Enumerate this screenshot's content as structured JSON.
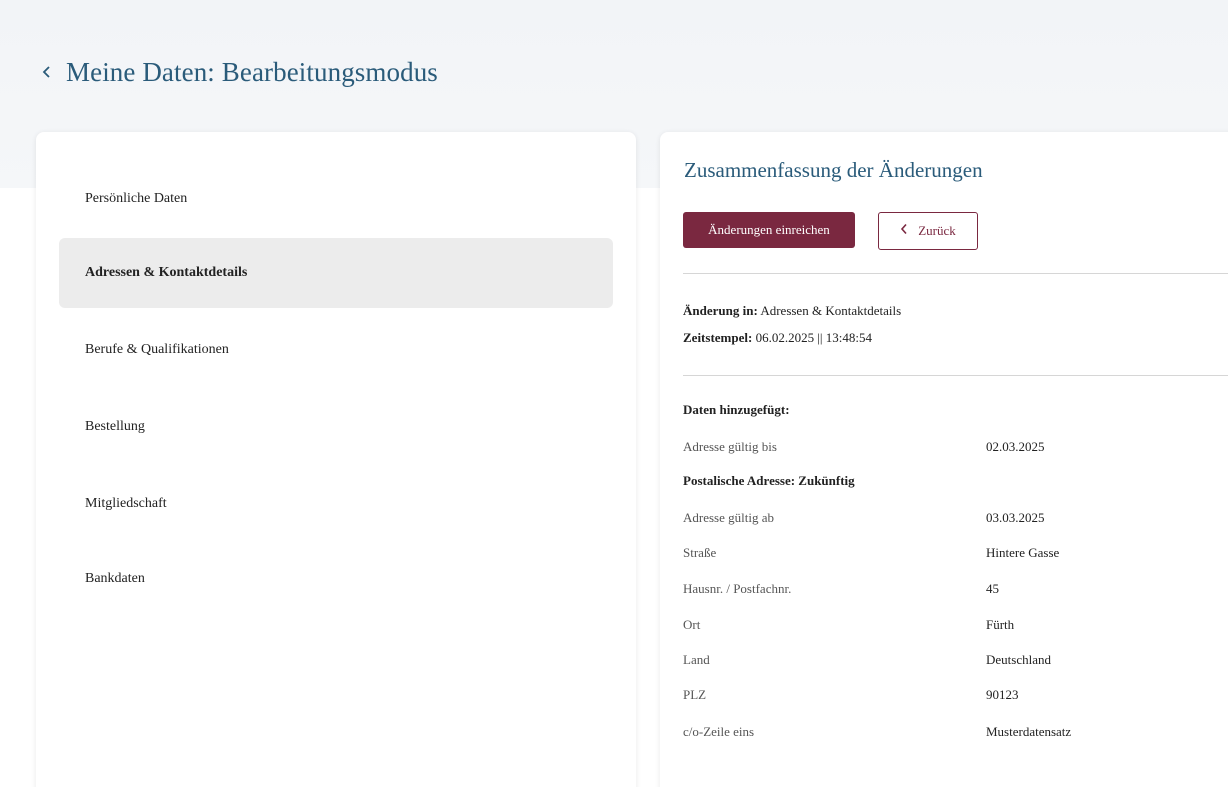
{
  "header": {
    "title": "Meine Daten: Bearbeitungsmodus"
  },
  "sidebar": {
    "items": [
      {
        "label": "Persönliche Daten",
        "active": false
      },
      {
        "label": "Adressen & Kontaktdetails",
        "active": true
      },
      {
        "label": "Berufe & Qualifikationen",
        "active": false
      },
      {
        "label": "Bestellung",
        "active": false
      },
      {
        "label": "Mitgliedschaft",
        "active": false
      },
      {
        "label": "Bankdaten",
        "active": false
      }
    ]
  },
  "summary": {
    "title": "Zusammenfassung der Änderungen",
    "submit_label": "Änderungen einreichen",
    "back_label": "Zurück",
    "change_in_label": "Änderung in:",
    "change_in_value": "Adressen & Kontaktdetails",
    "timestamp_label": "Zeitstempel:",
    "timestamp_value": "06.02.2025 || 13:48:54",
    "added_heading": "Daten hinzugefügt:",
    "rows_a": [
      {
        "label": "Adresse gültig bis",
        "value": "02.03.2025"
      }
    ],
    "subheading": "Postalische Adresse: Zukünftig",
    "rows_b": [
      {
        "label": "Adresse gültig ab",
        "value": "03.03.2025"
      },
      {
        "label": "Straße",
        "value": "Hintere Gasse"
      },
      {
        "label": "Hausnr. / Postfachnr.",
        "value": "45"
      },
      {
        "label": "Ort",
        "value": "Fürth"
      },
      {
        "label": "Land",
        "value": "Deutschland"
      },
      {
        "label": "PLZ",
        "value": "90123"
      },
      {
        "label": "c/o-Zeile eins",
        "value": "Musterdatensatz"
      }
    ]
  },
  "colors": {
    "accent": "#7a2840",
    "title_blue": "#2a5b7a",
    "active_bg": "#ececec"
  },
  "icons": {
    "header_back": "chevron-left-icon",
    "button_back": "chevron-left-icon"
  }
}
